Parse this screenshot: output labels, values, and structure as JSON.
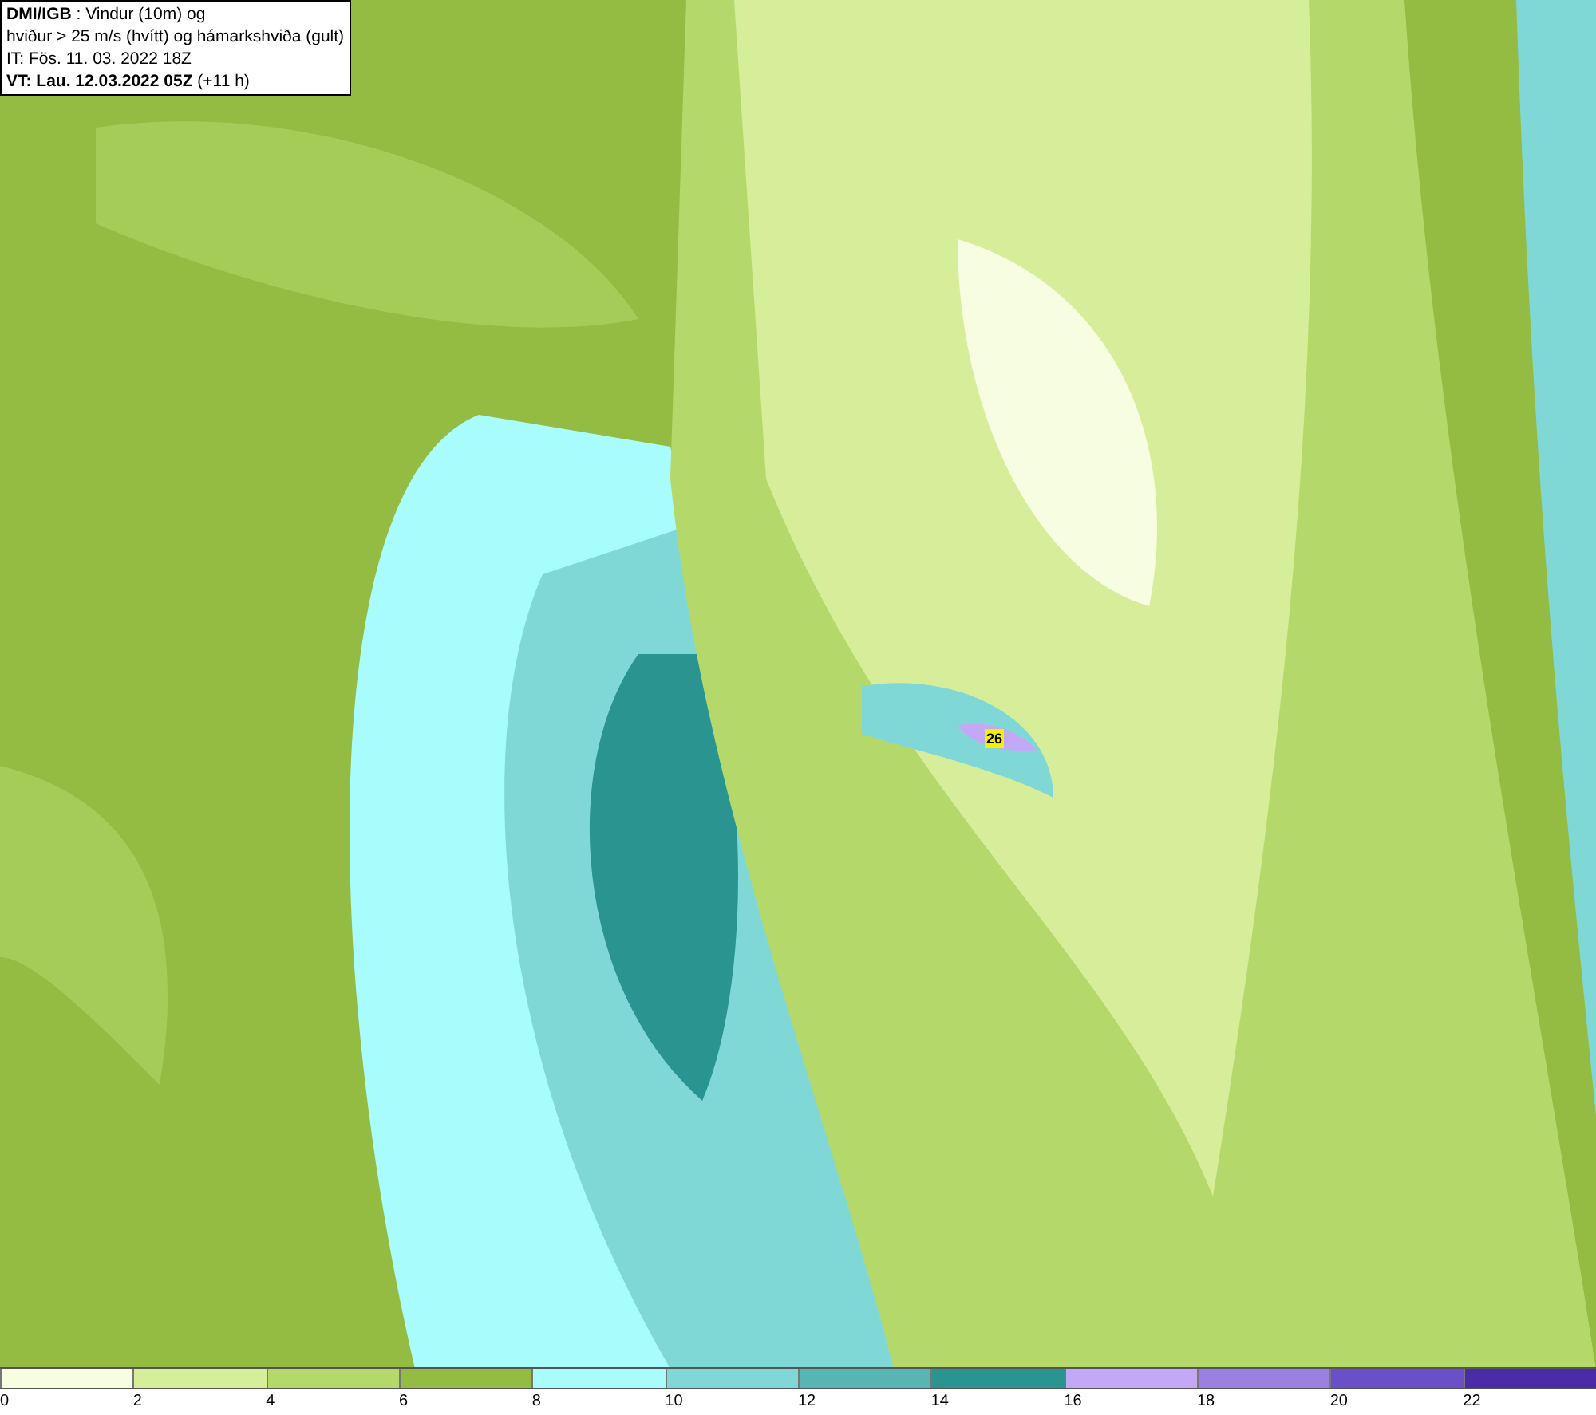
{
  "info_box": {
    "lines": [
      "**DMI/IGB** : Vindur (10m) og",
      "hviður > 25 m/s (hvítt) og hámarkshviða (gult)",
      "IT: Fös. 11. 03. 2022 18Z",
      "**VT: Lau. 12.03.2022 05Z** (+11 h)"
    ]
  },
  "map": {
    "gust_marker": "26"
  },
  "legend": [
    {
      "color": "#f7fde0",
      "label": "0"
    },
    {
      "color": "#d6ee9a",
      "label": "2"
    },
    {
      "color": "#b5d86a",
      "label": "4"
    },
    {
      "color": "#94bb42",
      "label": "6"
    },
    {
      "color": "#a8fcfc",
      "label": "8"
    },
    {
      "color": "#80d8d6",
      "label": "10"
    },
    {
      "color": "#58b6b2",
      "label": "12"
    },
    {
      "color": "#2a9490",
      "label": "14"
    },
    {
      "color": "#c4a8f8",
      "label": "16"
    },
    {
      "color": "#9a80e0",
      "label": "18"
    },
    {
      "color": "#6a50c8",
      "label": "20"
    },
    {
      "color": "#4a2ca8",
      "label": "22"
    }
  ]
}
